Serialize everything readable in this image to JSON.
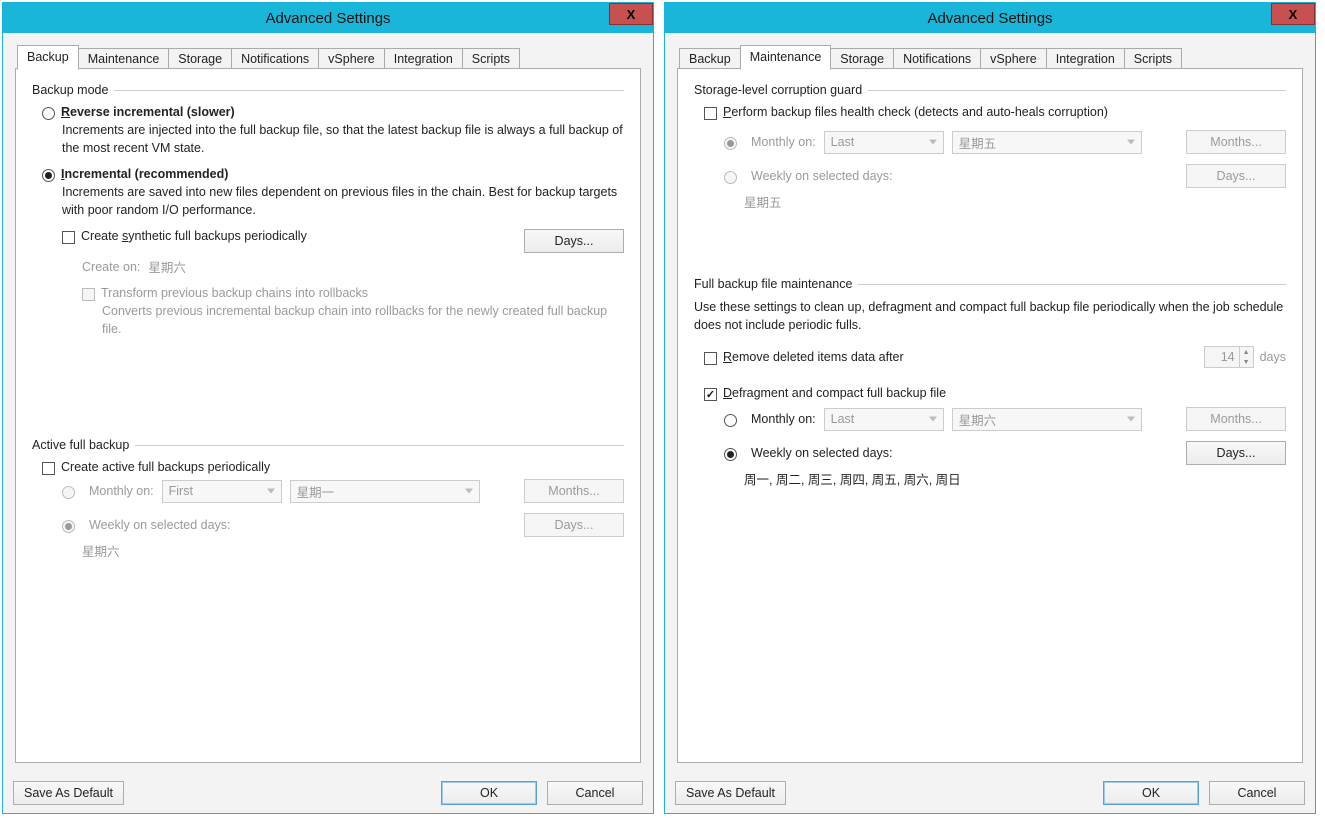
{
  "window_title": "Advanced Settings",
  "close_x": "X",
  "tabs": [
    "Backup",
    "Maintenance",
    "Storage",
    "Notifications",
    "vSphere",
    "Integration",
    "Scripts"
  ],
  "footer": {
    "save_default": "Save As Default",
    "ok": "OK",
    "cancel": "Cancel"
  },
  "left": {
    "active_tab": "Backup",
    "backup_mode": {
      "section": "Backup mode",
      "reverse_label_pre": "R",
      "reverse_label_post": "everse incremental (slower)",
      "reverse_desc": "Increments are injected into the full backup file, so that the latest backup file is always a full backup of the most recent VM state.",
      "incremental_label_pre": "I",
      "incremental_label_post": "ncremental (recommended)",
      "incremental_desc": "Increments are saved into new files dependent on previous files in the chain. Best for backup targets with poor random I/O performance.",
      "synthetic_label_pre": "Create ",
      "synthetic_label_ul": "s",
      "synthetic_label_post": "ynthetic full backups periodically",
      "days_btn_pre": "D",
      "days_btn_ul": "a",
      "days_btn_post": "ys...",
      "create_on_label": "Create on:",
      "create_on_value": "星期六",
      "transform_label": "Transform previous backup chains into rollbacks",
      "transform_desc": "Converts previous incremental backup chain into rollbacks for the newly created full backup file."
    },
    "active_full": {
      "section": "Active full backup",
      "create_label": "Create active full backups periodically",
      "monthly_label_pre": "M",
      "monthly_label_post": "onthly on:",
      "monthly_pos": "First",
      "monthly_day": "星期一",
      "months_btn_pre": "Mont",
      "months_btn_ul": "h",
      "months_btn_post": "s...",
      "weekly_label_pre": "W",
      "weekly_label_post": "eekly on selected days:",
      "days_btn": "Days...",
      "weekly_value": "星期六"
    }
  },
  "right": {
    "active_tab": "Maintenance",
    "guard": {
      "section": "Storage-level corruption guard",
      "perform_label_pre": "P",
      "perform_label_post": "erform backup files health check (detects and auto-heals corruption)",
      "monthly_label_pre": "M",
      "monthly_label_post": "onthly on:",
      "monthly_pos": "Last",
      "monthly_day": "星期五",
      "months_btn_pre": "Mo",
      "months_btn_ul": "n",
      "months_btn_post": "ths...",
      "weekly_label_pre": "W",
      "weekly_label_post": "eekly on selected days:",
      "days_btn_pre": "Da",
      "days_btn_ul": "y",
      "days_btn_post": "s...",
      "weekly_value": "星期五"
    },
    "maint": {
      "section": "Full backup file maintenance",
      "intro": "Use these settings to clean up, defragment and compact full backup file periodically when the job schedule does not include periodic fulls.",
      "remove_label_pre": "R",
      "remove_label_post": "emove deleted items data after",
      "remove_days_value": "14",
      "remove_days_suffix": "days",
      "defrag_label_pre": "D",
      "defrag_label_post": "efragment and compact full backup file",
      "monthly_label": "Monthly on:",
      "monthly_pos": "Last",
      "monthly_day": "星期六",
      "months_btn_pre": "Mont",
      "months_btn_ul": "h",
      "months_btn_post": "s...",
      "weekly_label": "Weekly on selected days:",
      "days_btn_pre": "D",
      "days_btn_ul": "a",
      "days_btn_post": "ys...",
      "weekly_value": "周一, 周二, 周三, 周四, 周五, 周六, 周日"
    }
  }
}
